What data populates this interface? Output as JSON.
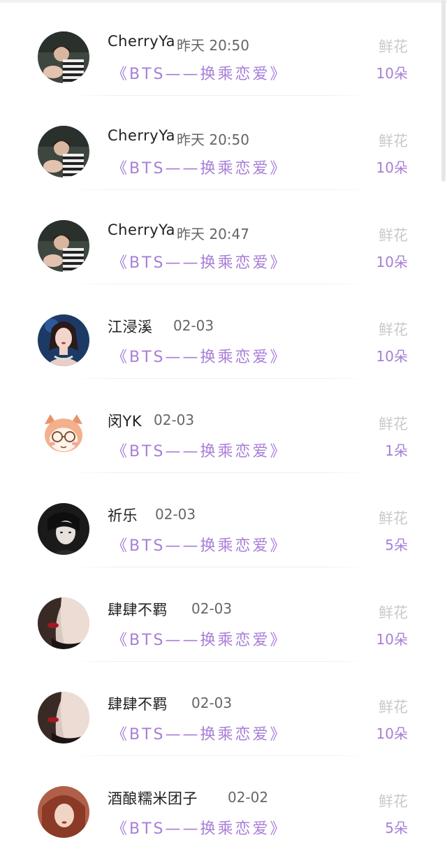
{
  "rows": [
    {
      "name": "CherryYa",
      "time": "昨天 20:50",
      "book": "《BTS——换乘恋爱》",
      "gift": "鲜花",
      "count": "10朵",
      "avatar": "avatar-stripes"
    },
    {
      "name": "CherryYa",
      "time": "昨天 20:50",
      "book": "《BTS——换乘恋爱》",
      "gift": "鲜花",
      "count": "10朵",
      "avatar": "avatar-stripes"
    },
    {
      "name": "CherryYa",
      "time": "昨天 20:47",
      "book": "《BTS——换乘恋爱》",
      "gift": "鲜花",
      "count": "10朵",
      "avatar": "avatar-stripes"
    },
    {
      "name": "江浸溪",
      "time": "02-03",
      "book": "《BTS——换乘恋爱》",
      "gift": "鲜花",
      "count": "10朵",
      "avatar": "avatar-woman"
    },
    {
      "name": "闵YK",
      "time": "02-03",
      "book": "《BTS——换乘恋爱》",
      "gift": "鲜花",
      "count": "1朵",
      "avatar": "avatar-cartoon"
    },
    {
      "name": "祈乐",
      "time": "02-03",
      "book": "《BTS——换乘恋爱》",
      "gift": "鲜花",
      "count": "5朵",
      "avatar": "avatar-dark"
    },
    {
      "name": "肆肆不羁",
      "time": "02-03",
      "book": "《BTS——换乘恋爱》",
      "gift": "鲜花",
      "count": "10朵",
      "avatar": "avatar-lips"
    },
    {
      "name": "肆肆不羁",
      "time": "02-03",
      "book": "《BTS——换乘恋爱》",
      "gift": "鲜花",
      "count": "10朵",
      "avatar": "avatar-lips"
    },
    {
      "name": "酒酿糯米团子",
      "time": "02-02",
      "book": "《BTS——换乘恋爱》",
      "gift": "鲜花",
      "count": "5朵",
      "avatar": "avatar-redhair"
    }
  ],
  "colors": {
    "accent": "#a77ed8",
    "name": "#222222",
    "time": "#666666",
    "gift": "#c9c9c9"
  }
}
